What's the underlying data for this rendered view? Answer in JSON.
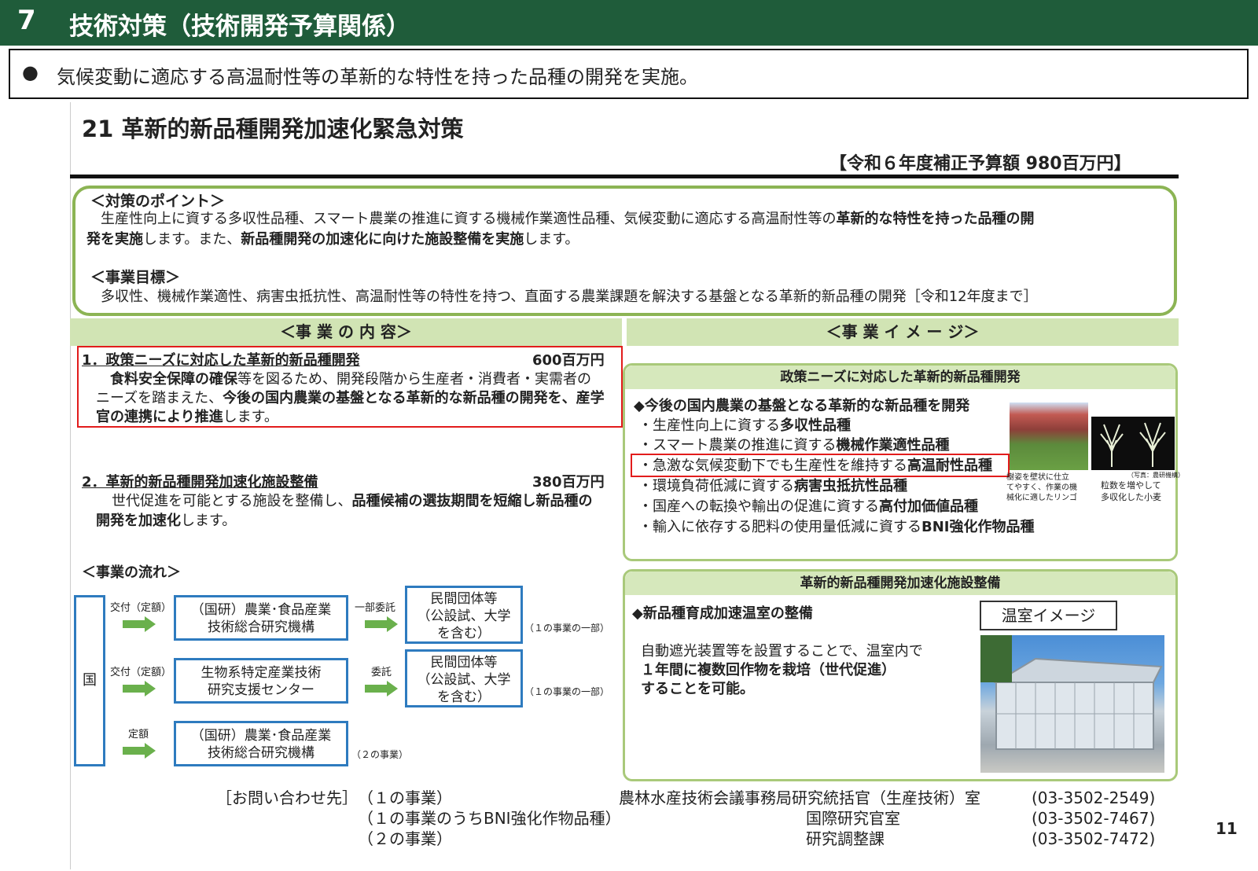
{
  "header": {
    "number": "7",
    "title": "技術対策（技術開発予算関係）"
  },
  "summary": {
    "bullet": "●",
    "text": "気候変動に適応する高温耐性等の革新的な特性を持った品種の開発を実施。"
  },
  "section": {
    "title": "21 革新的新品種開発加速化緊急対策",
    "budget": "【令和６年度補正予算額 980百万円】"
  },
  "points": {
    "heading": "＜対策のポイント＞",
    "line1_a": "生産性向上に資する多収性品種、スマート農業の推進に資する機械作業適性品種、気候変動に適応する高温耐性等の",
    "line1_b": "革新的な特性を持った品種の開",
    "line2_a": "発を実施",
    "line2_b": "します。また、",
    "line2_c": "新品種開発の加速化に向けた施設整備を実施",
    "line2_d": "します。",
    "goal_heading": "＜事業目標＞",
    "goal_text": "多収性、機械作業適性、病害虫抵抗性、高温耐性等の特性を持つ、直面する農業課題を解決する基盤となる革新的新品種の開発［令和12年度まで］"
  },
  "content": {
    "band": "＜事 業 の 内 容＞",
    "item1": {
      "title": "1．政策ニーズに対応した革新的新品種開発",
      "amount": "600百万円",
      "l1_bold": "食料安全保障の確保",
      "l1_rest": "等を図るため、開発段階から生産者・消費者・実需者の",
      "l2_a": "ニーズを踏まえた、",
      "l2_b": "今後の国内農業の基盤となる革新的な新品種の開発を、産学",
      "l3_bold": "官の連携により推進",
      "l3_rest": "します。"
    },
    "item2": {
      "title": "2．革新的新品種開発加速化施設整備",
      "amount": "380百万円",
      "l1_a": "世代促進を可能とする施設を整備し、",
      "l1_b": "品種候補の選抜期間を短縮し新品種の",
      "l2_bold": "開発を加速化",
      "l2_rest": "します。"
    }
  },
  "image_side": {
    "band": "＜事 業 イ メ ー ジ＞",
    "panel1": {
      "head": "政策ニーズに対応した革新的新品種開発",
      "lead": "◆今後の国内農業の基盤となる革新的な新品種を開発",
      "items": [
        {
          "a": "・生産性向上に資する",
          "b": "多収性品種"
        },
        {
          "a": "・スマート農業の推進に資する",
          "b": "機械作業適性品種"
        },
        {
          "a": "・急激な気候変動下でも生産性を維持する",
          "b": "高温耐性品種"
        },
        {
          "a": "・環境負荷低減に資する",
          "b": "病害虫抵抗性品種"
        },
        {
          "a": "・国産への転換や輸出の促進に資する",
          "b": "高付加価値品種"
        },
        {
          "a": "・輸入に依存する肥料の使用量低減に資する",
          "b": "BNI強化作物品種"
        }
      ],
      "caption_apple": [
        "樹姿を壁状に仕立",
        "てやすく、作業の機",
        "械化に適したリンゴ"
      ],
      "photo_credit": "（写真：農研機構）",
      "caption_wheat": [
        "粒数を増やして",
        "多収化した小麦"
      ]
    },
    "panel2": {
      "head": "革新的新品種開発加速化施設整備",
      "lead": "◆新品種育成加速温室の整備",
      "label": "温室イメージ",
      "l1": "自動遮光装置等を設置することで、温室内で",
      "l2": "１年間に複数回作物を栽培（世代促進）",
      "l3": "することを可能。"
    }
  },
  "flow": {
    "heading": "＜事業の流れ＞",
    "country": "国",
    "rows": [
      {
        "label": "交付（定額）",
        "org": [
          "（国研）農業･食品産業",
          "技術総合研究機構"
        ],
        "relay": "一部委託",
        "dest": [
          "民間団体等",
          "（公設試、大学",
          "を含む）"
        ],
        "note": "（１の事業の一部）"
      },
      {
        "label": "交付（定額）",
        "org": [
          "生物系特定産業技術",
          "研究支援センター"
        ],
        "relay": "委託",
        "dest": [
          "民間団体等",
          "（公設試、大学",
          "を含む）"
        ],
        "note": "（１の事業の一部）"
      },
      {
        "label": "定額",
        "org": [
          "（国研）農業･食品産業",
          "技術総合研究機構"
        ],
        "note": "（２の事業）"
      }
    ]
  },
  "contacts": {
    "label": "［お問い合わせ先］",
    "rows": [
      {
        "scope": "（１の事業）",
        "office": "農林水産技術会議事務局研究統括官（生産技術）室",
        "phone": "(03-3502-2549)"
      },
      {
        "scope": "（１の事業のうちBNI強化作物品種）",
        "office": "国際研究官室",
        "phone": "(03-3502-7467)"
      },
      {
        "scope": "（２の事業）",
        "office": "研究調整課",
        "phone": "(03-3502-7472)"
      }
    ]
  },
  "page_number": "11",
  "colors": {
    "header_green": "#1f5c3a",
    "band_green": "#d1e4b4",
    "panel_border": "#a9c97a",
    "flow_blue": "#2e7bbf",
    "highlight_red": "#e21c1c",
    "arrow_green": "#6ab04c"
  }
}
